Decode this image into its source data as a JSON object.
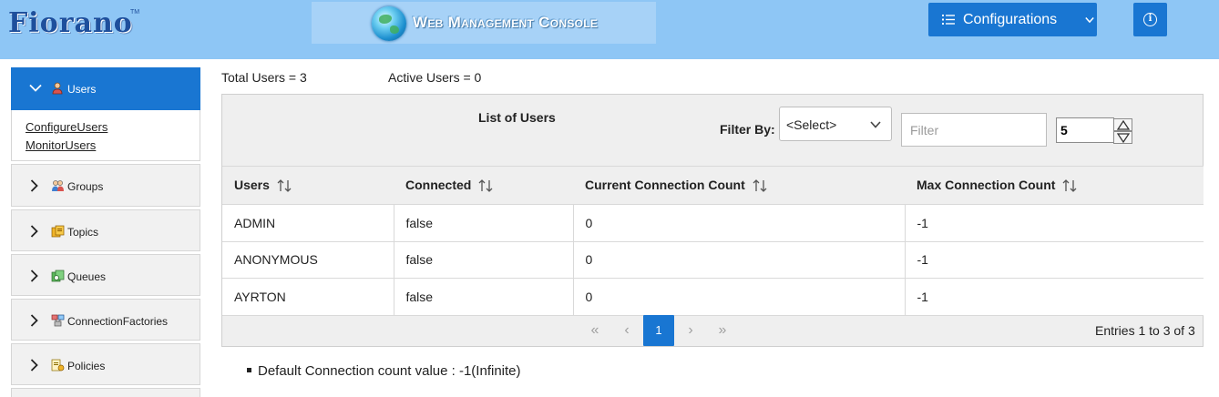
{
  "header": {
    "logo_text": "Fiorano",
    "logo_tm": "TM",
    "console_title": "Web Management Console",
    "configurations_label": "Configurations"
  },
  "sidebar": {
    "active_item": {
      "label": "Users",
      "icon": "user-icon"
    },
    "sub_links": [
      "ConfigureUsers",
      "MonitorUsers"
    ],
    "items": [
      {
        "label": "Groups",
        "icon": "groups-icon"
      },
      {
        "label": "Topics",
        "icon": "topics-icon"
      },
      {
        "label": "Queues",
        "icon": "queues-icon"
      },
      {
        "label": "ConnectionFactories",
        "icon": "connection-factories-icon"
      },
      {
        "label": "Policies",
        "icon": "policies-icon"
      }
    ]
  },
  "main": {
    "total_users": "Total Users = 3",
    "active_users": "Active Users = 0",
    "list_title": "List of Users",
    "filter_by_label": "Filter By:",
    "filter_select_value": "<Select>",
    "filter_placeholder": "Filter",
    "page_size": "5",
    "columns": [
      "Users",
      "Connected",
      "Current Connection Count",
      "Max Connection Count"
    ],
    "rows": [
      [
        "ADMIN",
        "false",
        "0",
        "-1"
      ],
      [
        "ANONYMOUS",
        "false",
        "0",
        "-1"
      ],
      [
        "AYRTON",
        "false",
        "0",
        "-1"
      ]
    ],
    "pager": {
      "first": "«",
      "prev": "‹",
      "current": "1",
      "next": "›",
      "last": "»"
    },
    "entries_text": "Entries 1 to 3 of 3",
    "note": "Default Connection count value : -1(Infinite)"
  },
  "colors": {
    "header_bg": "#8ec6f5",
    "accent": "#1976d2"
  }
}
